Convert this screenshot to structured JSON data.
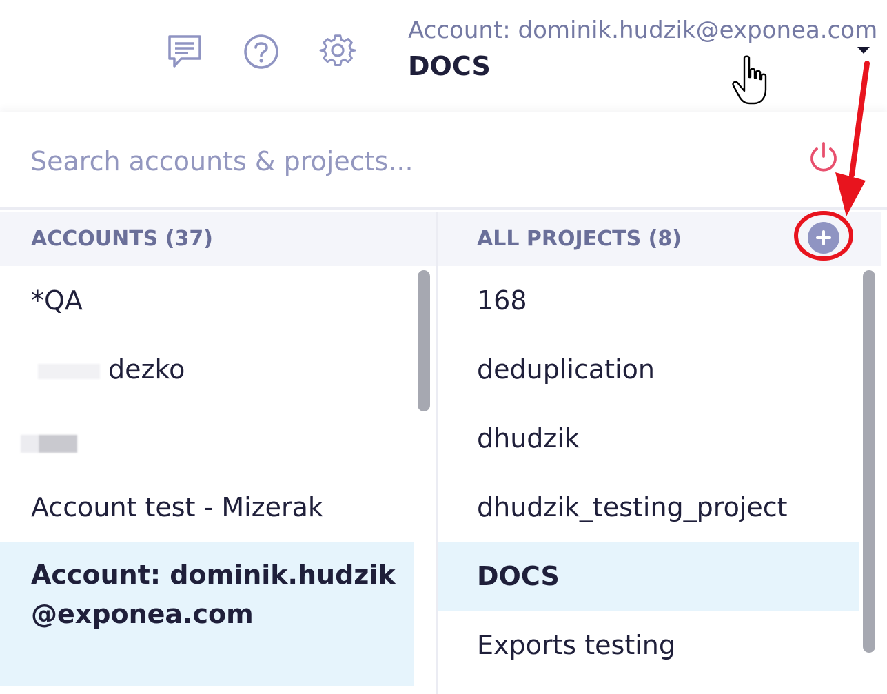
{
  "header": {
    "icons": [
      "feedback-icon",
      "help-icon",
      "settings-icon"
    ],
    "account_label": "Account: dominik.hudzik@exponea.com",
    "project_name": "DOCS"
  },
  "search": {
    "placeholder": "Search accounts & projects...",
    "value": ""
  },
  "accounts": {
    "header": "ACCOUNTS (37)",
    "items": [
      {
        "label": "*QA"
      },
      {
        "label": "dezko"
      },
      {
        "label": ""
      },
      {
        "label": "Account test - Mizerak"
      },
      {
        "label": "Account: dominik.hudzik@exponea.com",
        "selected": true
      }
    ]
  },
  "projects": {
    "header": "ALL PROJECTS (8)",
    "items": [
      {
        "label": "168"
      },
      {
        "label": "deduplication"
      },
      {
        "label": "dhudzik"
      },
      {
        "label": "dhudzik_testing_project"
      },
      {
        "label": "DOCS",
        "selected": true
      },
      {
        "label": "Exports testing"
      }
    ]
  },
  "colors": {
    "accent": "#8f94c2",
    "header_text": "#6a6f99",
    "selected_row": "#e6f4fc",
    "logout": "#e8506e",
    "annotation": "#e8141e"
  }
}
